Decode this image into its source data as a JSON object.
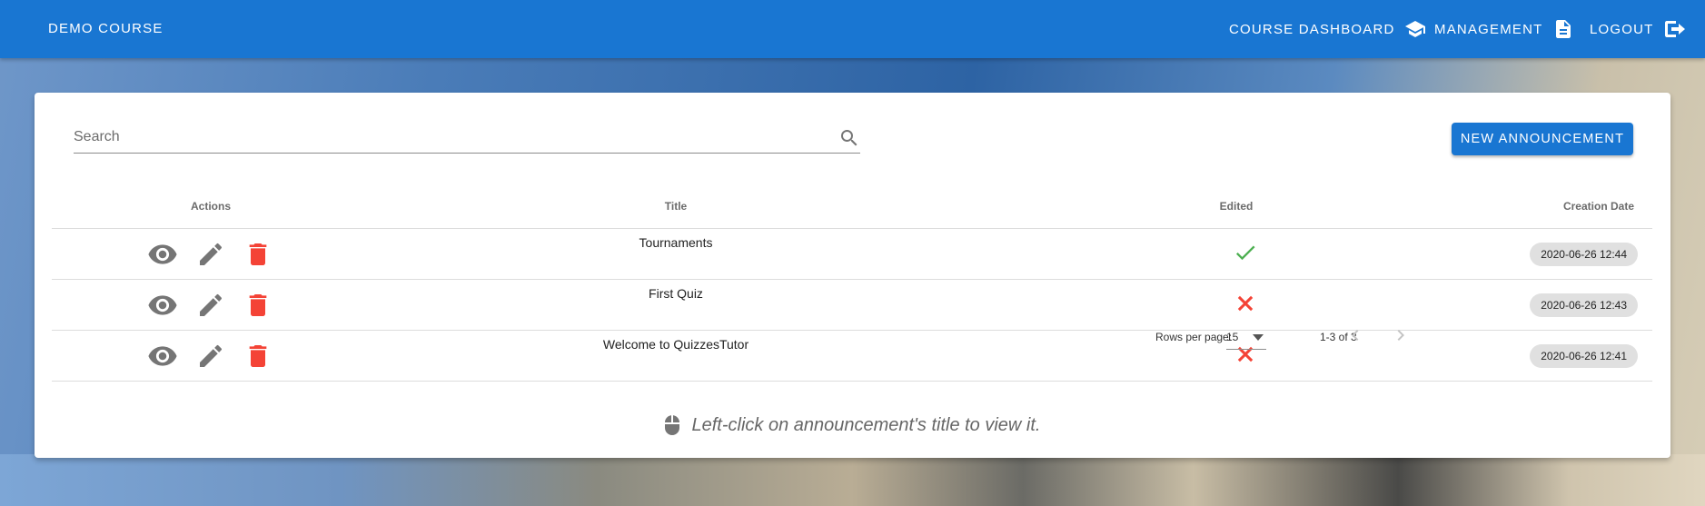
{
  "appbar": {
    "brand": "DEMO COURSE",
    "nav": [
      {
        "label": "COURSE DASHBOARD",
        "icon": "school-icon"
      },
      {
        "label": "MANAGEMENT",
        "icon": "file-document-icon"
      },
      {
        "label": "LOGOUT",
        "icon": "logout-icon"
      }
    ]
  },
  "search": {
    "label": "Search"
  },
  "new_button": {
    "label": "NEW ANNOUNCEMENT"
  },
  "table": {
    "headers": {
      "actions": "Actions",
      "title": "Title",
      "edited": "Edited",
      "creation_date": "Creation Date"
    },
    "rows": [
      {
        "title": "Tournaments",
        "edited": true,
        "creation_date": "2020-06-26 12:44"
      },
      {
        "title": "First Quiz",
        "edited": false,
        "creation_date": "2020-06-26 12:43"
      },
      {
        "title": "Welcome to QuizzesTutor",
        "edited": false,
        "creation_date": "2020-06-26 12:41"
      }
    ]
  },
  "pagination": {
    "rows_per_page_label": "Rows per page:",
    "rows_per_page": "15",
    "range": "1-3 of 3"
  },
  "hint": {
    "text": "Left-click on announcement's title to view it."
  },
  "colors": {
    "primary": "#1976d2",
    "delete": "#f44336",
    "edited_yes": "#4caf50",
    "edited_no": "#f44336",
    "icon_gray": "#757575"
  }
}
